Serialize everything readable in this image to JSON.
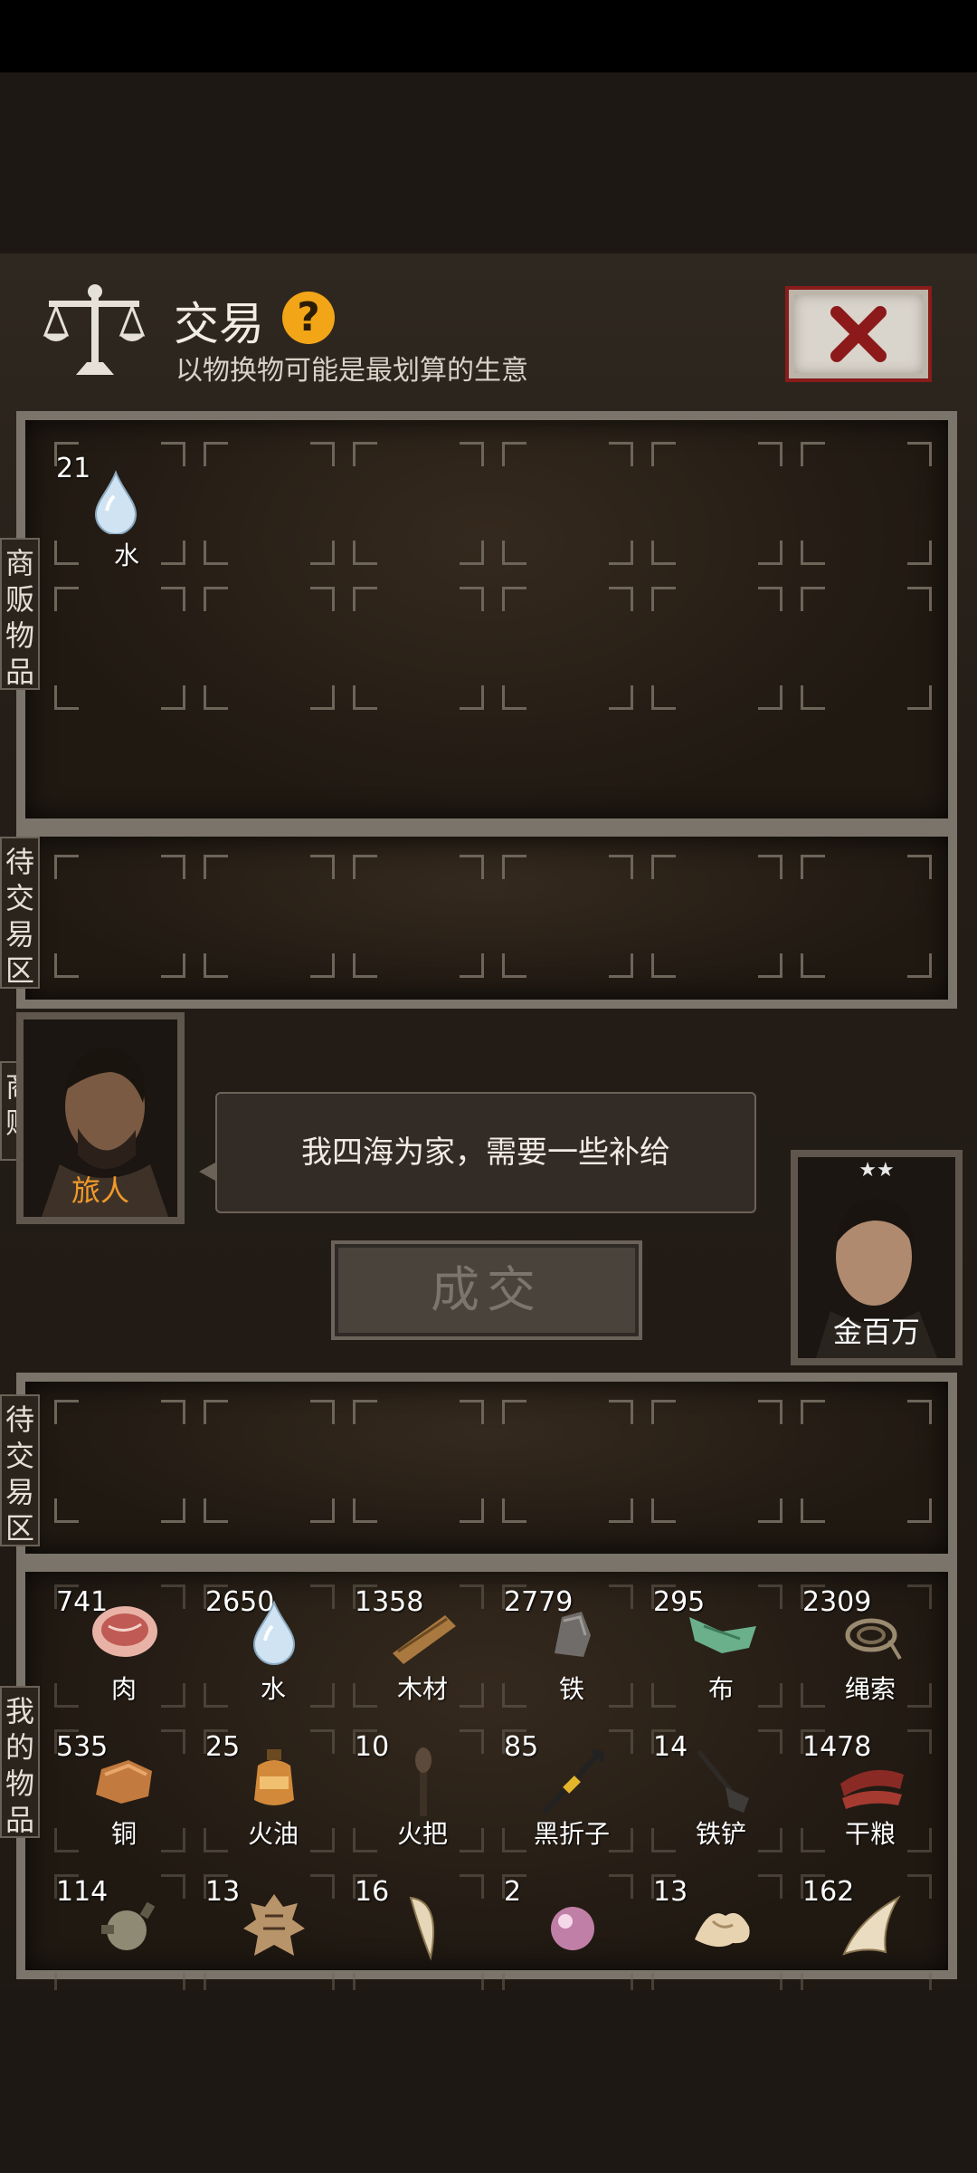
{
  "header": {
    "title": "交易",
    "help_icon": "?",
    "subtitle": "以物换物可能是最划算的生意"
  },
  "side_tabs": {
    "merchant_goods": "商贩物品",
    "pending_merchant": "待交易区",
    "merchant": "商贩",
    "pending_mine": "待交易区",
    "my_goods": "我的物品"
  },
  "merchant_items": [
    {
      "qty": "21",
      "label": "水",
      "icon": "water-drop-icon"
    }
  ],
  "merchant": {
    "name": "旅人",
    "speech": "我四海为家，需要一些补给"
  },
  "deal_button": "成交",
  "player": {
    "name": "金百万",
    "stars": "★★"
  },
  "my_items": [
    {
      "qty": "741",
      "label": "肉",
      "icon": "meat-icon"
    },
    {
      "qty": "2650",
      "label": "水",
      "icon": "water-drop-icon"
    },
    {
      "qty": "1358",
      "label": "木材",
      "icon": "wood-icon"
    },
    {
      "qty": "2779",
      "label": "铁",
      "icon": "iron-icon"
    },
    {
      "qty": "295",
      "label": "布",
      "icon": "cloth-icon"
    },
    {
      "qty": "2309",
      "label": "绳索",
      "icon": "rope-icon"
    },
    {
      "qty": "535",
      "label": "铜",
      "icon": "copper-icon"
    },
    {
      "qty": "25",
      "label": "火油",
      "icon": "fuel-oil-icon"
    },
    {
      "qty": "10",
      "label": "火把",
      "icon": "torch-icon"
    },
    {
      "qty": "85",
      "label": "黑折子",
      "icon": "crowbar-icon"
    },
    {
      "qty": "14",
      "label": "铁铲",
      "icon": "shovel-icon"
    },
    {
      "qty": "1478",
      "label": "干粮",
      "icon": "dried-food-icon"
    },
    {
      "qty": "114",
      "label": "",
      "icon": "flask-icon"
    },
    {
      "qty": "13",
      "label": "",
      "icon": "animal-hide-icon"
    },
    {
      "qty": "16",
      "label": "",
      "icon": "fang-icon"
    },
    {
      "qty": "2",
      "label": "",
      "icon": "pearl-icon"
    },
    {
      "qty": "13",
      "label": "",
      "icon": "bone-icon"
    },
    {
      "qty": "162",
      "label": "",
      "icon": "claw-icon"
    }
  ]
}
